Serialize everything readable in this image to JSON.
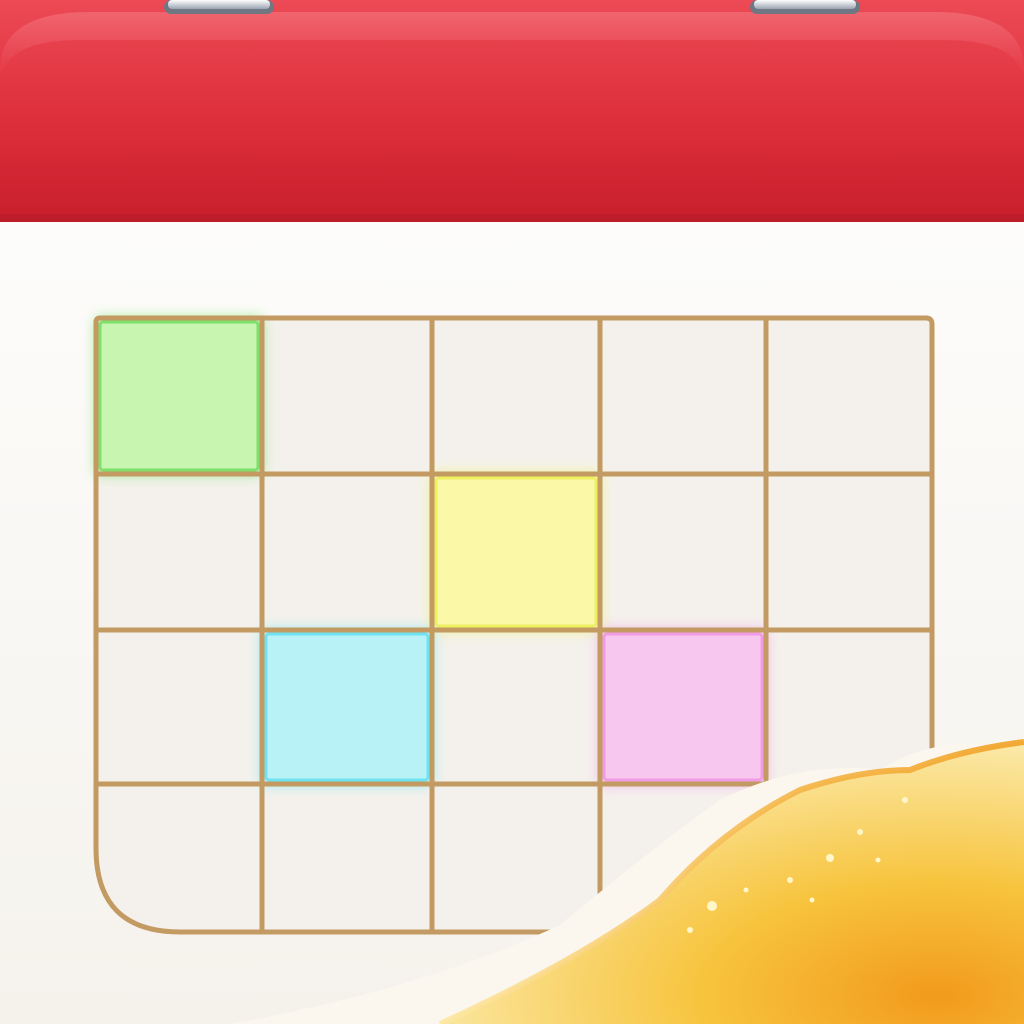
{
  "icon": {
    "name": "calendar-app-icon",
    "header_color": "#e2313f",
    "header_dark": "#c81e2c",
    "page_color": "#fbfaf7",
    "grid_line_color": "#c29a62",
    "curl_color": "#f6b733",
    "grid": {
      "rows": 4,
      "columns": 5,
      "highlighted_cells": [
        {
          "row": 0,
          "col": 0,
          "color": "#c8f5b0",
          "glow": "#7fe06a"
        },
        {
          "row": 1,
          "col": 2,
          "color": "#fbf8a8",
          "glow": "#eef060"
        },
        {
          "row": 2,
          "col": 1,
          "color": "#b8f1f6",
          "glow": "#6fe3f1"
        },
        {
          "row": 2,
          "col": 3,
          "color": "#f8c7ef",
          "glow": "#f09be3"
        }
      ]
    }
  }
}
